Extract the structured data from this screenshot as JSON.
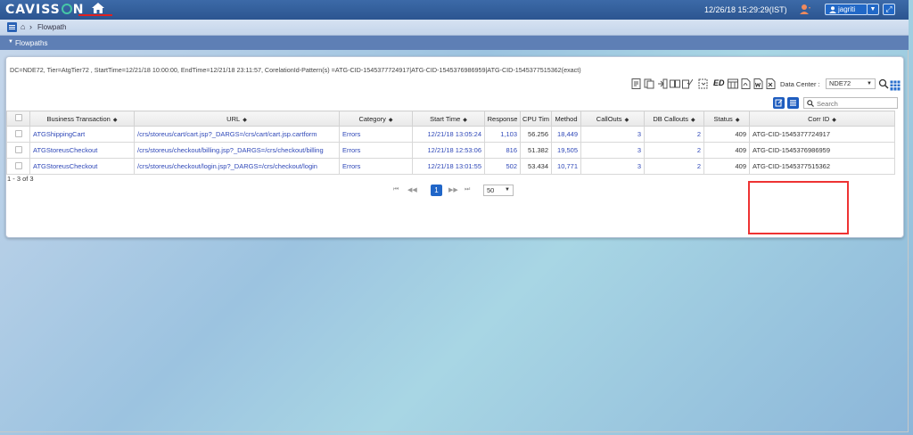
{
  "app": {
    "logo_text_left": "CAVISS",
    "logo_text_right": "N",
    "datetime": "12/26/18 15:29:29(IST)",
    "user_name": "jagriti"
  },
  "breadcrumb": {
    "page": "Flowpath"
  },
  "section": {
    "title": "Flowpaths"
  },
  "filter": {
    "text": "DC=NDE72, Tier=AtgTier72 , StartTime=12/21/18 10:00:00, EndTime=12/21/18 23:11:57, CorelationId-Pattern(s) =ATG-CID-1545377724917|ATG-CID-1545376986959|ATG-CID-1545377515362(exact)"
  },
  "toolbar": {
    "data_center_label": "Data Center :",
    "data_center_value": "NDE72",
    "search_placeholder": "Search"
  },
  "table": {
    "columns": [
      "Business Transaction",
      "URL",
      "Category",
      "Start Time",
      "Response",
      "CPU Tim",
      "Method",
      "CallOuts",
      "DB Callouts",
      "Status",
      "Corr ID"
    ],
    "rows": [
      {
        "bt": "ATGShippingCart",
        "url": "/crs/storeus/cart/cart.jsp?_DARGS=/crs/cart/cart.jsp.cartform",
        "category": "Errors",
        "start": "12/21/18 13:05:24",
        "response": "1,103",
        "cpu": "56.256",
        "method": "18,449",
        "callouts": "3",
        "db": "2",
        "status": "409",
        "corr": "ATG-CID-1545377724917"
      },
      {
        "bt": "ATGStoreusCheckout",
        "url": "/crs/storeus/checkout/billing.jsp?_DARGS=/crs/checkout/billing",
        "category": "Errors",
        "start": "12/21/18 12:53:06",
        "response": "816",
        "cpu": "51.382",
        "method": "19,505",
        "callouts": "3",
        "db": "2",
        "status": "409",
        "corr": "ATG-CID-1545376986959"
      },
      {
        "bt": "ATGStoreusCheckout",
        "url": "/crs/storeus/checkout/login.jsp?_DARGS=/crs/checkout/login",
        "category": "Errors",
        "start": "12/21/18 13:01:55",
        "response": "502",
        "cpu": "53.434",
        "method": "10,771",
        "callouts": "3",
        "db": "2",
        "status": "409",
        "corr": "ATG-CID-1545377515362"
      }
    ],
    "range_text": "1 - 3 of 3"
  },
  "pager": {
    "first": "⏮",
    "prev": "◀◀",
    "current": "1",
    "next": "▶▶",
    "last": "⏭",
    "page_size": "50"
  },
  "colors": {
    "topbar": "#2c5590",
    "accent": "#2066c8",
    "link": "#2f48b8",
    "highlight_box": "#e33333"
  }
}
